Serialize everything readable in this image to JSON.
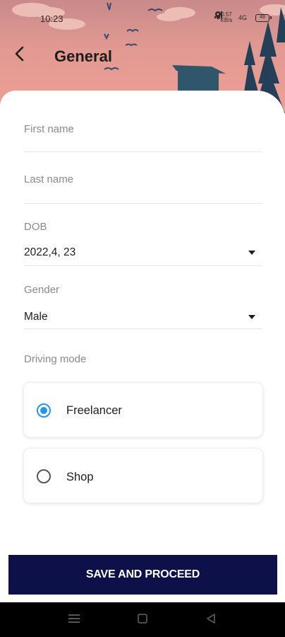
{
  "status_bar": {
    "time": "10:23",
    "speed": "0.57 KB/s",
    "network": "4G",
    "battery": "48"
  },
  "app_bar": {
    "title": "General",
    "back_icon": "arrow-left-icon"
  },
  "form": {
    "first_name": {
      "placeholder": "First name",
      "value": ""
    },
    "last_name": {
      "placeholder": "Last name",
      "value": ""
    },
    "dob": {
      "label": "DOB",
      "value": "2022,4, 23"
    },
    "gender": {
      "label": "Gender",
      "value": "Male"
    },
    "driving_mode": {
      "label": "Driving mode",
      "options": [
        {
          "label": "Freelancer",
          "selected": true
        },
        {
          "label": "Shop",
          "selected": false
        }
      ]
    }
  },
  "save_button": {
    "label": "SAVE AND PROCEED"
  },
  "colors": {
    "primary_button": "#0e1049",
    "radio_selected": "#2196f3",
    "header_sky": "#ee9f95"
  },
  "nav_bar": {
    "icons": [
      "menu-icon",
      "home-square-icon",
      "back-triangle-icon"
    ]
  }
}
